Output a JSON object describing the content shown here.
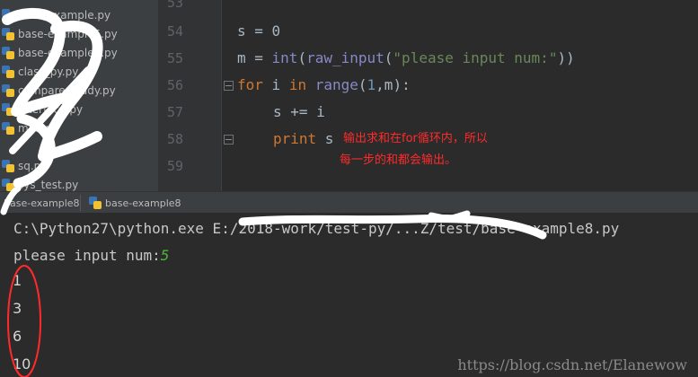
{
  "sidebar": {
    "items": [
      {
        "label": "base-example.py"
      },
      {
        "label": "base-example5.py"
      },
      {
        "label": "base-example8.py"
      },
      {
        "label": "class_py.py"
      },
      {
        "label": "compare_study.py"
      },
      {
        "label": "interface.py"
      },
      {
        "label": "md5.py"
      },
      {
        "label": "sq.py"
      },
      {
        "label": "sys_test.py"
      }
    ]
  },
  "editor": {
    "line_numbers": [
      "53",
      "54",
      "55",
      "56",
      "57",
      "58",
      "59"
    ],
    "code": {
      "l54": "s = 0",
      "l55_var": "m = ",
      "l55_int": "int",
      "l55_p1": "(",
      "l55_raw": "raw_input",
      "l55_p2": "(",
      "l55_str": "\"please input num:\"",
      "l55_p3": "))",
      "l56_for": "for",
      "l56_i": " i ",
      "l56_in": "in",
      "l56_sp": " ",
      "l56_range": "range",
      "l56_p1": "(",
      "l56_one": "1",
      "l56_rest": ",m):",
      "l57": "s += i",
      "l58_print": "print",
      "l58_rest": " s"
    },
    "annotation": {
      "line1": "输出求和在for循环内，所以",
      "line2": "每一步的和都会输出。"
    }
  },
  "run_tabs": [
    {
      "label": "base-example8"
    },
    {
      "label": "base-example8"
    }
  ],
  "console": {
    "command": "C:\\Python27\\python.exe E:/2018-work/test-py/...Z/test/base-example8.py",
    "prompt": "please input num:",
    "input_value": "5",
    "outputs": [
      "1",
      "3",
      "6",
      "10"
    ]
  },
  "watermark": "https://blog.csdn.net/Elanewow",
  "colors": {
    "annotation": "#ff2a2a",
    "scribble": "#ffffff"
  }
}
